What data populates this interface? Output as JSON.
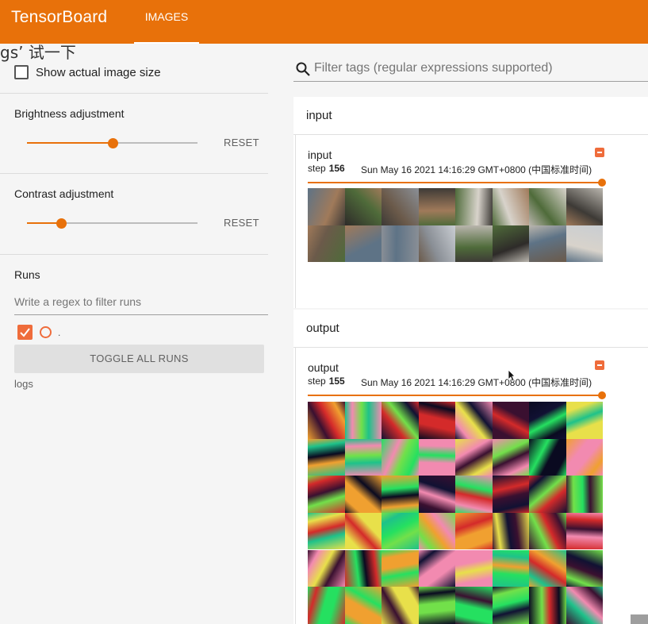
{
  "app": {
    "title": "TensorBoard",
    "active_tab": "IMAGES"
  },
  "overlay": {
    "text": "gs’ 试一下"
  },
  "sidebar": {
    "show_actual_size_label": "Show actual image size",
    "show_actual_size_checked": false,
    "brightness": {
      "title": "Brightness adjustment",
      "value": 0.5,
      "reset_label": "RESET"
    },
    "contrast": {
      "title": "Contrast adjustment",
      "value": 0.2,
      "reset_label": "RESET"
    },
    "runs": {
      "title": "Runs",
      "filter_placeholder": "Write a regex to filter runs",
      "items": [
        {
          "name": ".",
          "checked": true
        }
      ],
      "toggle_all_label": "TOGGLE ALL RUNS",
      "logdir": "logs"
    }
  },
  "filter": {
    "placeholder": "Filter tags (regular expressions supported)"
  },
  "groups": [
    {
      "name": "input",
      "card": {
        "tag": "input",
        "step_label": "step",
        "step": "156",
        "timestamp": "Sun May 16 2021 14:16:29 GMT+0800 (中国标准时间)",
        "slider_value": 1.0
      }
    },
    {
      "name": "output",
      "card": {
        "tag": "output",
        "step_label": "step",
        "step": "155",
        "timestamp": "Sun May 16 2021 14:16:29 GMT+0800 (中国标准时间)",
        "slider_value": 1.0
      }
    }
  ],
  "colors": {
    "accent": "#e8710a",
    "run_color": "#ef6c3b"
  },
  "icons": {
    "search": "search-icon",
    "fullscreen": "fullscreen-icon",
    "check": "check-icon"
  }
}
